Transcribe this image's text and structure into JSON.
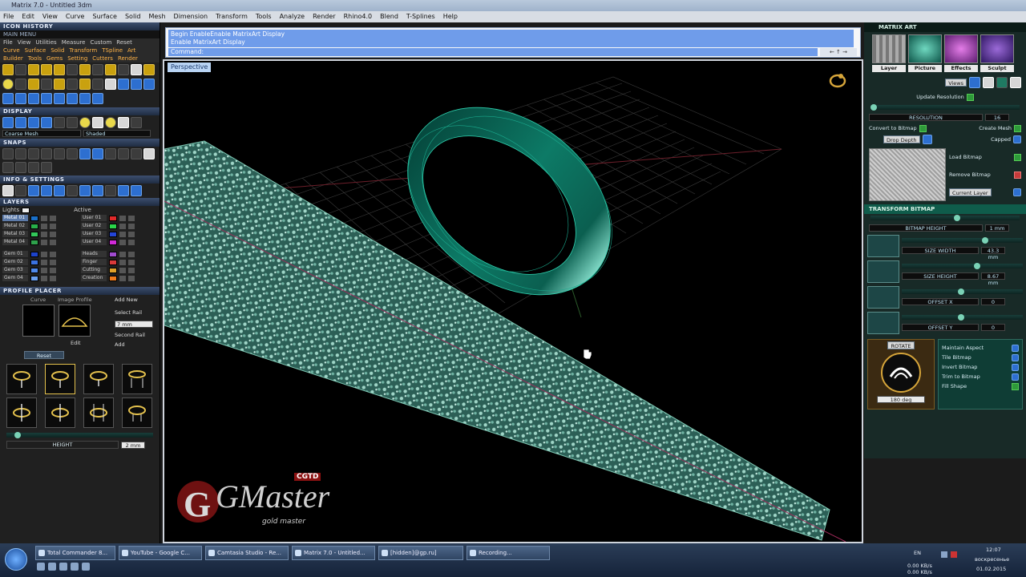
{
  "titlebar": {
    "text": "Matrix 7.0 - Untitled 3dm"
  },
  "menubar": [
    "File",
    "Edit",
    "View",
    "Curve",
    "Surface",
    "Solid",
    "Mesh",
    "Dimension",
    "Transform",
    "Tools",
    "Analyze",
    "Render",
    "Rhino4.0",
    "Blend",
    "T-Splines",
    "Help"
  ],
  "left_panel": {
    "icon_history_title": "ICON HISTORY",
    "main_menu_title": "MAIN MENU",
    "menu_tabs": [
      "File",
      "View",
      "Utilities",
      "Measure",
      "Custom",
      "Reset"
    ],
    "orange_tabs": [
      "Curve",
      "Surface",
      "Solid",
      "Transform",
      "TSpline",
      "Art",
      "Builder",
      "Tools",
      "Gems",
      "Setting",
      "Cutters",
      "Render"
    ],
    "display_title": "DISPLAY",
    "display_field1": "Coarse Mesh",
    "display_field2": "Shaded",
    "snaps_title": "SNAPS",
    "info_title": "INFO & SETTINGS",
    "layers_title": "LAYERS",
    "lights_label": "Lights",
    "active_label": "Active",
    "layers_left": [
      {
        "name": "Metal 01",
        "color": "#1a6fc7"
      },
      {
        "name": "Metal 02",
        "color": "#28b04a"
      },
      {
        "name": "Metal 03",
        "color": "#33c75a"
      },
      {
        "name": "Metal 04",
        "color": "#2fa14c"
      },
      {
        "name": "Gem 01",
        "color": "#1d43c9"
      },
      {
        "name": "Gem 02",
        "color": "#3b72e0"
      },
      {
        "name": "Gem 03",
        "color": "#4f89ea"
      },
      {
        "name": "Gem 04",
        "color": "#6aa0ef"
      }
    ],
    "layers_right": [
      {
        "name": "User 01",
        "color": "#e02a2a"
      },
      {
        "name": "User 02",
        "color": "#2bd64a"
      },
      {
        "name": "User 03",
        "color": "#2445d8"
      },
      {
        "name": "User 04",
        "color": "#d02ad8"
      },
      {
        "name": "Heads",
        "color": "#a04bd0"
      },
      {
        "name": "Finger",
        "color": "#d93a3a"
      },
      {
        "name": "Cutting",
        "color": "#e0a22a"
      },
      {
        "name": "Creation",
        "color": "#f07a1c"
      }
    ],
    "profile_title": "PROFILE PLACER",
    "curve_label": "Curve",
    "image_profile_label": "Image Profile",
    "edit_label": "Edit",
    "add_new_label": "Add New",
    "select_rail_label": "Select Rail",
    "second_rail_label": "Second Rail",
    "add_label": "Add",
    "mm_value": "7 mm",
    "reset_label": "Reset",
    "height_label": "HEIGHT",
    "height_value": "2 mm"
  },
  "command": {
    "history_line1": "Begin EnableEnable MatrixArt Display",
    "history_line2": "Enable MatrixArt Display",
    "prompt": "Command:",
    "controls": "← ↑ →"
  },
  "viewport": {
    "title": "Perspective",
    "watermark_main": "GMaster",
    "watermark_badge": "CGTD",
    "watermark_sub": "gold master"
  },
  "right_panel": {
    "title": "MATRIX ART",
    "thumbs": [
      "Layer",
      "Picture",
      "Effects",
      "Sculpt"
    ],
    "views_label": "Views",
    "update_resolution": "Update Resolution",
    "resolution_label": "RESOLUTION",
    "resolution_value": "16",
    "convert_to_bitmap": "Convert to Bitmap",
    "create_mesh": "Create Mesh",
    "drop_depth": "Drop Depth",
    "capped": "Capped",
    "load_bitmap": "Load Bitmap",
    "remove_bitmap": "Remove Bitmap",
    "current_layer": "Current Layer",
    "transform_bitmap": "TRANSFORM BITMAP",
    "bitmap_height": "BITMAP HEIGHT",
    "bitmap_height_value": "1 mm",
    "size_width": "SIZE WIDTH",
    "size_width_value": "43.3 mm",
    "size_height": "SIZE HEIGHT",
    "size_height_value": "8.67 mm",
    "offset_x": "OFFSET X",
    "offset_x_value": "0",
    "offset_y": "OFFSET Y",
    "offset_y_value": "0",
    "rotate_label": "ROTATE",
    "rotate_value": "180 deg",
    "options": [
      "Maintain Aspect",
      "Tile Bitmap",
      "Invert Bitmap",
      "Trim to Bitmap",
      "Fill Shape"
    ]
  },
  "taskbar": {
    "buttons": [
      "Total Commander 8...",
      "YouTube - Google C...",
      "Camtasia Studio - Re...",
      "Matrix 7.0 - Untitled...",
      "[hidden]@gp.ru]",
      "Recording..."
    ],
    "lang": "EN",
    "net1": "0.00 KB/s",
    "net2": "0.00 KB/s",
    "time": "12:07",
    "day": "воскресенье",
    "date": "01.02.2015"
  }
}
